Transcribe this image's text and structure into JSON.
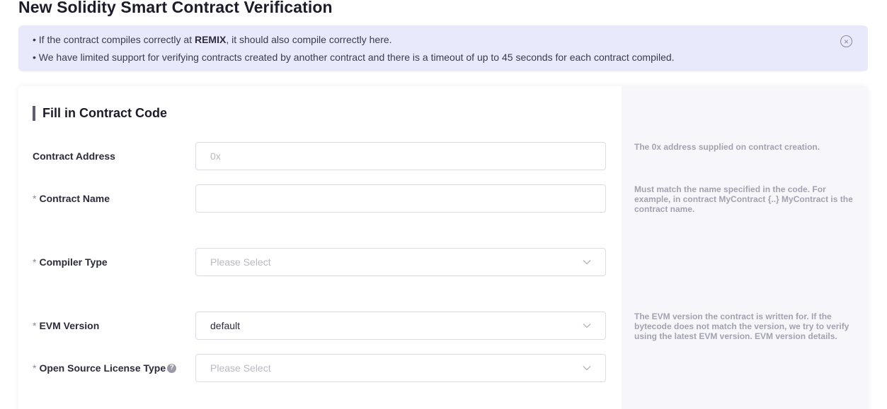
{
  "page_title": "New Solidity Smart Contract Verification",
  "notice": {
    "line1_prefix": "• If the contract compiles correctly at ",
    "line1_bold": "REMIX",
    "line1_suffix": ", it should also compile correctly here.",
    "line2": "• We have limited support for verifying contracts created by another contract and there is a timeout of up to 45 seconds for each contract compiled."
  },
  "section_title": "Fill in Contract Code",
  "required_mark": "*",
  "help_glyph": "?",
  "fields": {
    "contract_address": {
      "label": "Contract Address",
      "value": "",
      "placeholder": "0x",
      "hint": "The 0x address supplied on contract creation."
    },
    "contract_name": {
      "label": "Contract Name",
      "value": "",
      "placeholder": "",
      "hint": "Must match the name specified in the code. For example, in contract MyContract {..} MyContract is the contract name."
    },
    "compiler_type": {
      "label": "Compiler Type",
      "selected": "Please Select",
      "hint": ""
    },
    "evm_version": {
      "label": "EVM Version",
      "selected": "default",
      "hint": "The EVM version the contract is written for. If the bytecode does not match the version, we try to verify using the latest EVM version. EVM version details."
    },
    "license_type": {
      "label": "Open Source License Type",
      "selected": "Please Select",
      "hint": ""
    }
  },
  "colors": {
    "notice_bg": "#e8e9fb",
    "hint_panel_bg": "#f7f7fb",
    "section_accent": "#5e5e70"
  },
  "icons": {
    "notice_close": "close-circle-icon",
    "select_arrow": "chevron-down-icon",
    "help": "question-circle-icon"
  }
}
